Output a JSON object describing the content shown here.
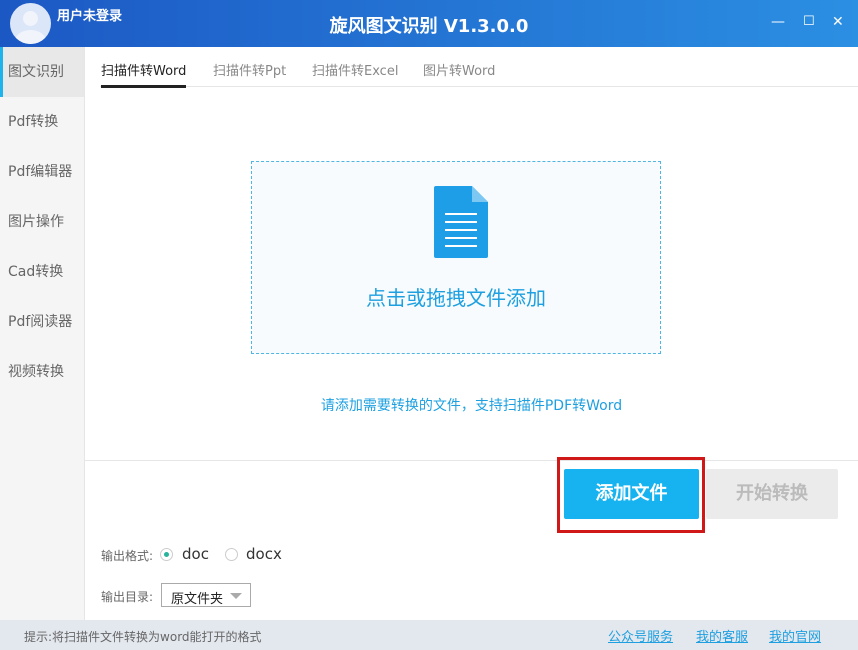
{
  "header": {
    "user": "用户未登录",
    "title": "旋风图文识别 V1.3.0.0",
    "minimize": "—",
    "maximize": "☐",
    "close": "✕"
  },
  "sidebar": {
    "items": [
      {
        "label": "图文识别"
      },
      {
        "label": "Pdf转换"
      },
      {
        "label": "Pdf编辑器"
      },
      {
        "label": "图片操作"
      },
      {
        "label": "Cad转换"
      },
      {
        "label": "Pdf阅读器"
      },
      {
        "label": "视频转换"
      }
    ]
  },
  "tabs": [
    {
      "label": "扫描件转Word"
    },
    {
      "label": "扫描件转Ppt"
    },
    {
      "label": "扫描件转Excel"
    },
    {
      "label": "图片转Word"
    }
  ],
  "dropzone": {
    "text": "点击或拖拽文件添加"
  },
  "hint": "请添加需要转换的文件，支持扫描件PDF转Word",
  "buttons": {
    "add": "添加文件",
    "start": "开始转换"
  },
  "output": {
    "format_label": "输出格式:",
    "formats": [
      "doc",
      "docx"
    ],
    "selected": "doc",
    "dir_label": "输出目录:",
    "dir_value": "原文件夹"
  },
  "status": {
    "tip": "提示:将扫描件文件转换为word能打开的格式",
    "links": [
      "公众号服务",
      "我的客服",
      "我的官网"
    ]
  },
  "colors": {
    "accent": "#17b3f0",
    "header": "#1c58c4"
  }
}
